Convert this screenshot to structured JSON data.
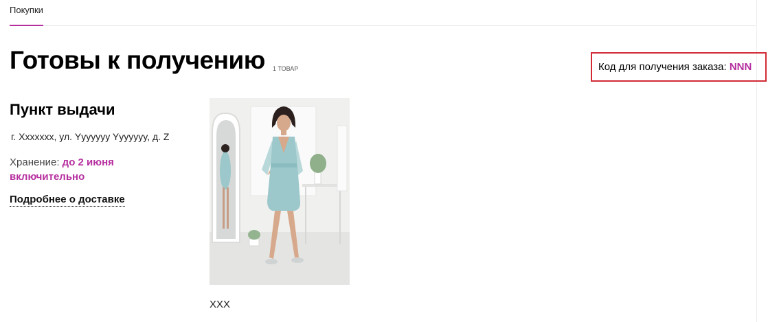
{
  "tabs": [
    {
      "label": "Покупки",
      "active": true
    }
  ],
  "heading": {
    "title": "Готовы к получению",
    "count": "1 товар"
  },
  "pickup_code": {
    "label": "Код для получения заказа:",
    "value": "NNN"
  },
  "pickup_point": {
    "title": "Пункт выдачи",
    "address": "г. Xxxxxxx, ул. Yyyyyyy Yyyyyyy, д. Z",
    "storage_label": "Хранение:",
    "storage_value": "до 2 июня включительно",
    "delivery_link": "Подробнее о доставке"
  },
  "product": {
    "name": "XXX",
    "image": "product-photo-woman-in-light-blue-dress"
  },
  "colors": {
    "accent": "#b62f9f",
    "highlight_border": "#d12a35",
    "dress": "#9cc8cb"
  }
}
